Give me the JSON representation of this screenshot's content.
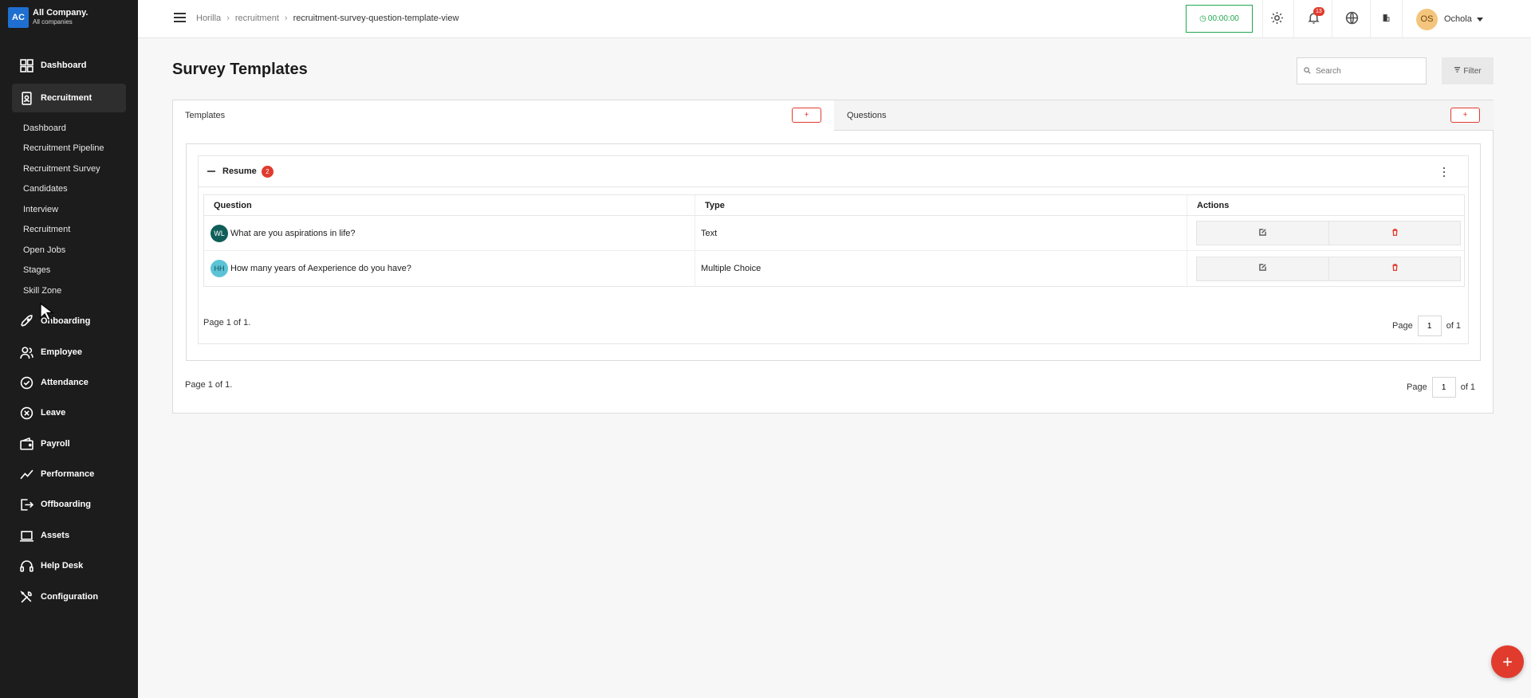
{
  "company": {
    "logo": "AC",
    "name": "All Company.",
    "subtitle": "All companies"
  },
  "nav": {
    "dashboard": "Dashboard",
    "recruitment": "Recruitment",
    "recruitment_sub": [
      "Dashboard",
      "Recruitment Pipeline",
      "Recruitment Survey",
      "Candidates",
      "Interview",
      "Recruitment",
      "Open Jobs",
      "Stages",
      "Skill Zone"
    ],
    "onboarding": "Onboarding",
    "employee": "Employee",
    "attendance": "Attendance",
    "leave": "Leave",
    "payroll": "Payroll",
    "performance": "Performance",
    "offboarding": "Offboarding",
    "assets": "Assets",
    "helpdesk": "Help Desk",
    "configuration": "Configuration"
  },
  "header": {
    "breadcrumb": [
      "Horilla",
      "recruitment",
      "recruitment-survey-question-template-view"
    ],
    "timer": "00:00:00",
    "notification_count": "13",
    "user_initials": "OS",
    "user_name": "Ochola"
  },
  "page": {
    "title": "Survey Templates",
    "search_placeholder": "Search",
    "filter_label": "Filter"
  },
  "tabs": {
    "templates": "Templates",
    "questions": "Questions",
    "add_label": "+"
  },
  "group": {
    "title": "Resume",
    "count": "2",
    "columns": [
      "Question",
      "Type",
      "Actions"
    ],
    "rows": [
      {
        "initials": "WL",
        "avatar_color": "#0f5e59",
        "question": "What are you aspirations in life?",
        "type": "Text"
      },
      {
        "initials": "HH",
        "avatar_color": "#5cc3d6",
        "question": "How many years of Aexperience do you have?",
        "type": "Multiple Choice"
      }
    ]
  },
  "pagination": {
    "inner_text": "Page 1 of 1.",
    "outer_text": "Page 1 of 1.",
    "page_label": "Page",
    "page_value": "1",
    "of_label": "of 1"
  },
  "fab": "+",
  "colors": {
    "accent": "#e03b2d",
    "timer_green": "#1fa84f",
    "sidebar_bg": "#1c1c1c"
  }
}
